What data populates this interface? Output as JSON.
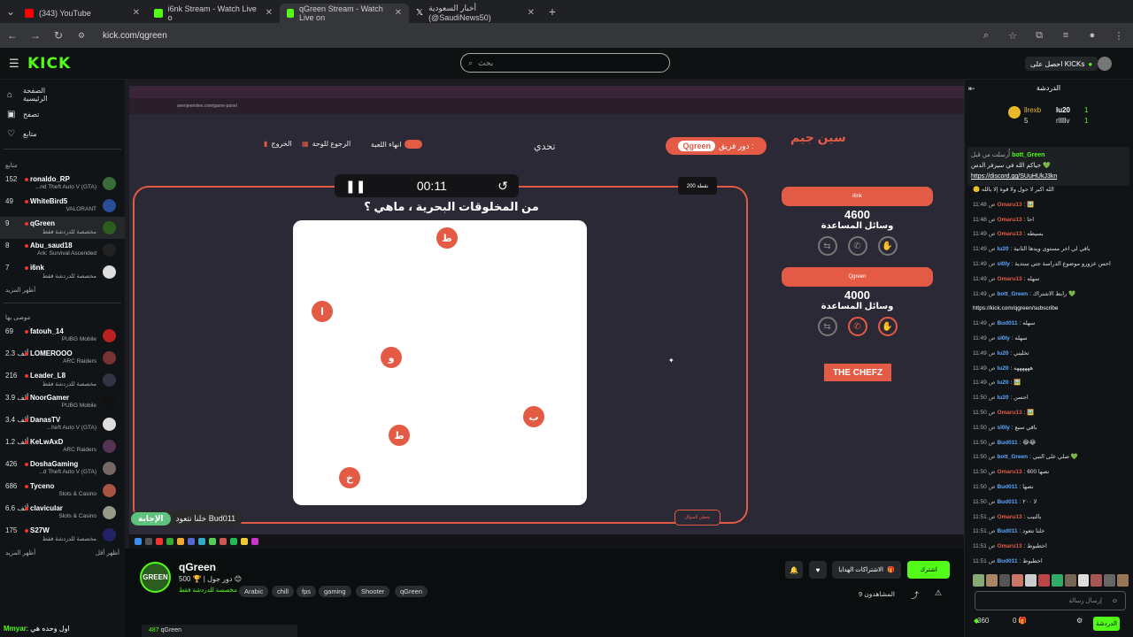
{
  "browser": {
    "tabs": [
      {
        "title": "(343) YouTube",
        "color": "#ff0000"
      },
      {
        "title": "i6nk Stream - Watch Live o",
        "color": "#53fc18"
      },
      {
        "title": "qGreen Stream - Watch Live on",
        "color": "#53fc18"
      },
      {
        "title": "أخبار السعودية (@SaudiNews50)",
        "color": "#ffffff"
      }
    ],
    "new_tab": "+",
    "url": "kick.com/qgreen"
  },
  "header": {
    "logo": "KICK",
    "search_placeholder": "بحث",
    "get_kicks": "احصل على KICKs"
  },
  "sidebar": {
    "nav": [
      {
        "label": "الصفحة الرئيسية",
        "icon": "home-icon"
      },
      {
        "label": "تصفح",
        "icon": "browse-icon"
      },
      {
        "label": "متابع",
        "icon": "heart-icon"
      }
    ],
    "following_title": "متابع",
    "following": [
      {
        "count": "152",
        "name": "ronaldo_RP",
        "category": "...nd Theft Auto V (GTA)",
        "avatar_color": "#3a6b3a"
      },
      {
        "count": "49",
        "name": "WhiteBird5",
        "category": "VALORANT",
        "avatar_color": "#2a4d9a"
      },
      {
        "count": "9",
        "name": "qGreen",
        "category": "مخصصة للدردشة فقط",
        "avatar_color": "#2a5d1e"
      },
      {
        "count": "8",
        "name": "Abu_saud18",
        "category": "Ark: Survival Ascended",
        "avatar_color": "#222"
      },
      {
        "count": "7",
        "name": "i6nk",
        "category": "مخصصة للدردشة فقط",
        "avatar_color": "#ddd"
      }
    ],
    "show_more_1": "أظهر المزيد",
    "recommended_title": "موصى بها",
    "recommended": [
      {
        "count": "69",
        "name": "fatouh_14",
        "category": "PUBG Mobile",
        "avatar_color": "#b22"
      },
      {
        "count": "2.3 ألف",
        "name": "LOMEROOO",
        "category": "ARC Raiders",
        "avatar_color": "#733"
      },
      {
        "count": "216",
        "name": "Leader_L8",
        "category": "مخصصة للدردشة فقط",
        "avatar_color": "#334"
      },
      {
        "count": "3.9 ألف",
        "name": "NoorGamer",
        "category": "PUBG Mobile",
        "avatar_color": "#111"
      },
      {
        "count": "3.4 ألف",
        "name": "DanasTV",
        "category": "...heft Auto V (GTA)",
        "avatar_color": "#ddd"
      },
      {
        "count": "1.2 ألف",
        "name": "KeLwAxD",
        "category": "ARC Raiders",
        "avatar_color": "#535"
      },
      {
        "count": "426",
        "name": "DoshaGaming",
        "category": "...d Theft Auto V (GTA)",
        "avatar_color": "#766"
      },
      {
        "count": "686",
        "name": "Tyceno",
        "category": "Slots & Casino",
        "avatar_color": "#a54"
      },
      {
        "count": "6.6 ألف",
        "name": "clavicular",
        "category": "Slots & Casino",
        "avatar_color": "#998"
      },
      {
        "count": "175",
        "name": "S27W",
        "category": "مخصصة للدردشة فقط",
        "avatar_color": "#226"
      }
    ],
    "show_more_2": "أظهر المزيد",
    "show_less": "أظهر أقل",
    "bottom_user": "Mmyar",
    "bottom_text": "اول وحده هي"
  },
  "stream": {
    "inner_url": "seenjeemlive.com/game-panel",
    "exit": "الخروج",
    "back_to_board": "الرجوع للوحة",
    "end_game": "انهاء اللعبة",
    "challenge": "تحدي",
    "team_turn": "دور فريق :",
    "team_turn_name": "Qgreen",
    "brand": "سين جيم",
    "timer": "00:11",
    "points": "200 نقطة",
    "question": "من المخلوقات البحرية ، ماهي ؟",
    "letters": [
      {
        "char": "ط",
        "id": "letter-1"
      },
      {
        "char": "ا",
        "id": "letter-2"
      },
      {
        "char": "و",
        "id": "letter-3"
      },
      {
        "char": "ب",
        "id": "letter-4"
      },
      {
        "char": "ط",
        "id": "letter-5"
      },
      {
        "char": "خ",
        "id": "letter-6"
      }
    ],
    "hint_label": "الإجابة",
    "hint_text": "خلنا نتعود Bud011",
    "skip": "تخطي السؤال",
    "team1_name": "i6nk",
    "team1_score": "4600",
    "team2_name": "Qgreen",
    "team2_score": "4000",
    "helps_label": "وسائل المساعدة",
    "sponsor": "THE CHEFZ"
  },
  "channel": {
    "avatar_text": "GREEN",
    "name": "qGreen",
    "followers": "500 🏆 | دور جول 😊",
    "subtitle": "مخصصة للدردشة فقط",
    "tags": [
      "Arabic",
      "chill",
      "fps",
      "gaming",
      "Shooter",
      "qGreen"
    ],
    "subscribe": "اشترك",
    "gift_subs": "الاشتراكات الهدايا",
    "viewers": "9 المشاهدون",
    "bottom_line_count": "487",
    "bottom_line_name": "qGreen"
  },
  "chat": {
    "title": "الدردشة",
    "leaders": [
      {
        "rank": "1",
        "name": "lu20",
        "value": "1"
      },
      {
        "rank": "2",
        "name": "rlllllv",
        "value": "1"
      },
      {
        "rank": "",
        "name": "llrexb",
        "value": "5"
      }
    ],
    "pinned_user": "bott_Green",
    "pinned_by": "أُرسلت من قبل",
    "pinned_text": "حياكم الله في سيرفر الدس 💚",
    "pinned_link": "https://discord.gg/SUuHUkJ3kn",
    "messages": [
      {
        "time": "",
        "user": "",
        "text": "🙂 الله اكبر لا حول ولا قوة إلا بالله",
        "color": "#ddd"
      },
      {
        "time": "11:48 ص",
        "user": "Omaru13",
        "text": "🖼️",
        "color": "#e35b45"
      },
      {
        "time": "11:48 ص",
        "user": "Omaru13",
        "text": "احا",
        "color": "#e35b45"
      },
      {
        "time": "11:49 ص",
        "user": "Omaru13",
        "text": "بسيطه",
        "color": "#e35b45"
      },
      {
        "time": "11:49 ص",
        "user": "lu20",
        "text": "باقي لي اخر مستوى ويدها الثانية",
        "color": "#5aa7ff"
      },
      {
        "time": "11:49 ص",
        "user": "sl0ly",
        "text": "احس عزورو موضوع الدراسة جتي ستدية",
        "color": "#5aa7ff"
      },
      {
        "time": "11:49 ص",
        "user": "Omaru13",
        "text": "سهله",
        "color": "#e35b45"
      },
      {
        "time": "11:49 ص",
        "user": "bott_Green",
        "text": "رابط الاشتراك 💚",
        "color": "#5aa7ff"
      },
      {
        "time": "",
        "user": "",
        "text": "https://kick.com/qgreen/subscribe",
        "color": "#fff"
      },
      {
        "time": "11:49 ص",
        "user": "Bud011",
        "text": "سهله",
        "color": "#5aa7ff"
      },
      {
        "time": "11:49 ص",
        "user": "sl0ly",
        "text": "سهله",
        "color": "#5aa7ff"
      },
      {
        "time": "11:49 ص",
        "user": "lu20",
        "text": "تخليني",
        "color": "#5aa7ff"
      },
      {
        "time": "11:49 ص",
        "user": "lu20",
        "text": "ههههههه",
        "color": "#5aa7ff"
      },
      {
        "time": "11:49 ص",
        "user": "lu20",
        "text": "🖼️",
        "color": "#5aa7ff"
      },
      {
        "time": "11:50 ص",
        "user": "lu20",
        "text": "احسن",
        "color": "#5aa7ff"
      },
      {
        "time": "11:50 ص",
        "user": "Omaru13",
        "text": "🖼️",
        "color": "#e35b45"
      },
      {
        "time": "11:50 ص",
        "user": "sl0ly",
        "text": "باقي سبع",
        "color": "#5aa7ff"
      },
      {
        "time": "11:50 ص",
        "user": "Bud011",
        "text": "😂😂",
        "color": "#5aa7ff"
      },
      {
        "time": "11:50 ص",
        "user": "bott_Green",
        "text": "صلي على النبي 💚",
        "color": "#5aa7ff"
      },
      {
        "time": "11:50 ص",
        "user": "Omaru13",
        "text": "نصها 600",
        "color": "#e35b45"
      },
      {
        "time": "11:50 ص",
        "user": "Bud011",
        "text": "نصها",
        "color": "#5aa7ff"
      },
      {
        "time": "11:50 ص",
        "user": "Bud011",
        "text": "لا ٢٠٠",
        "color": "#5aa7ff"
      },
      {
        "time": "11:51 ص",
        "user": "Omaru13",
        "text": "بالتيب",
        "color": "#e35b45"
      },
      {
        "time": "11:51 ص",
        "user": "Bud011",
        "text": "خلنا نتعود",
        "color": "#5aa7ff"
      },
      {
        "time": "11:51 ص",
        "user": "Omaru13",
        "text": "اخطبوط",
        "color": "#e35b45"
      },
      {
        "time": "11:51 ص",
        "user": "Bud011",
        "text": "اخطبوط",
        "color": "#5aa7ff"
      }
    ],
    "input_placeholder": "إرسال رسالة",
    "points": "360",
    "gift_count": "0",
    "send": "الدردشة"
  }
}
